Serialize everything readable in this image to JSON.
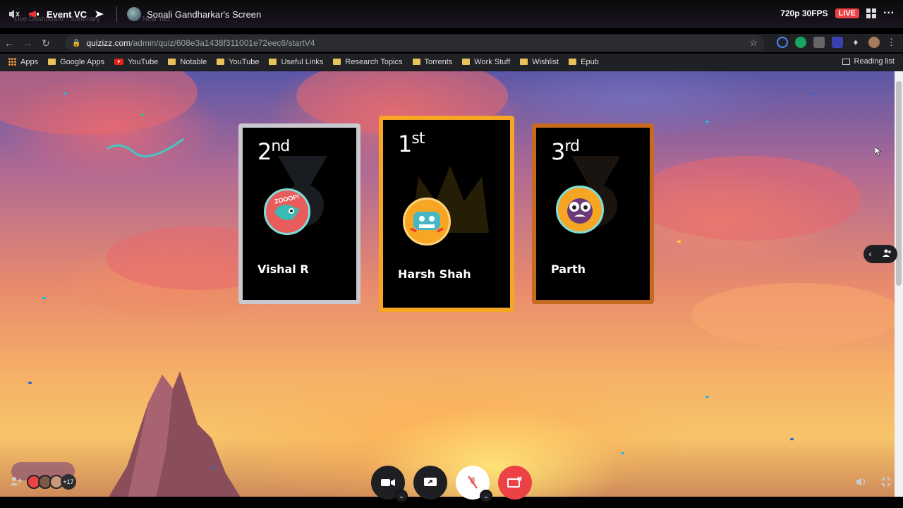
{
  "stream": {
    "channel_name": "Event VC",
    "screen_title": "Sonali Gandharkar's Screen",
    "quality": "720p 30FPS",
    "live_label": "LIVE",
    "more_label": "···"
  },
  "browser": {
    "ghost_tabs": [
      "Live Dashboard - Summary",
      "New Tab"
    ],
    "url_host": "quizizz.com",
    "url_path": "/admin/quiz/608e3a1438f311001e72eec6/startV4",
    "bookmarks": [
      {
        "label": "Apps",
        "icon": "apps-icon"
      },
      {
        "label": "Google Apps",
        "icon": "folder-icon"
      },
      {
        "label": "YouTube",
        "icon": "youtube-icon"
      },
      {
        "label": "Notable",
        "icon": "folder-icon"
      },
      {
        "label": "YouTube",
        "icon": "folder-icon"
      },
      {
        "label": "Useful Links",
        "icon": "folder-icon"
      },
      {
        "label": "Research Topics",
        "icon": "folder-icon"
      },
      {
        "label": "Torrents",
        "icon": "folder-icon"
      },
      {
        "label": "Work Stuff",
        "icon": "folder-icon"
      },
      {
        "label": "Wishlist",
        "icon": "folder-icon"
      },
      {
        "label": "Epub",
        "icon": "folder-icon"
      }
    ],
    "reading_list": "Reading list"
  },
  "podium": [
    {
      "rank_num": "2",
      "rank_suffix": "nd",
      "name": "Vishal R",
      "color": "#c9c9cf"
    },
    {
      "rank_num": "1",
      "rank_suffix": "st",
      "name": "Harsh Shah",
      "color": "#f6a623"
    },
    {
      "rank_num": "3",
      "rank_suffix": "rd",
      "name": "Parth",
      "color": "#c56a1e"
    }
  ],
  "avatar_text": "ZOOOP!",
  "participants": {
    "extra_count": "+17"
  },
  "colors": {
    "live": "#ed4245",
    "gold": "#f6a623",
    "silver": "#c9c9cf",
    "bronze": "#c56a1e"
  }
}
